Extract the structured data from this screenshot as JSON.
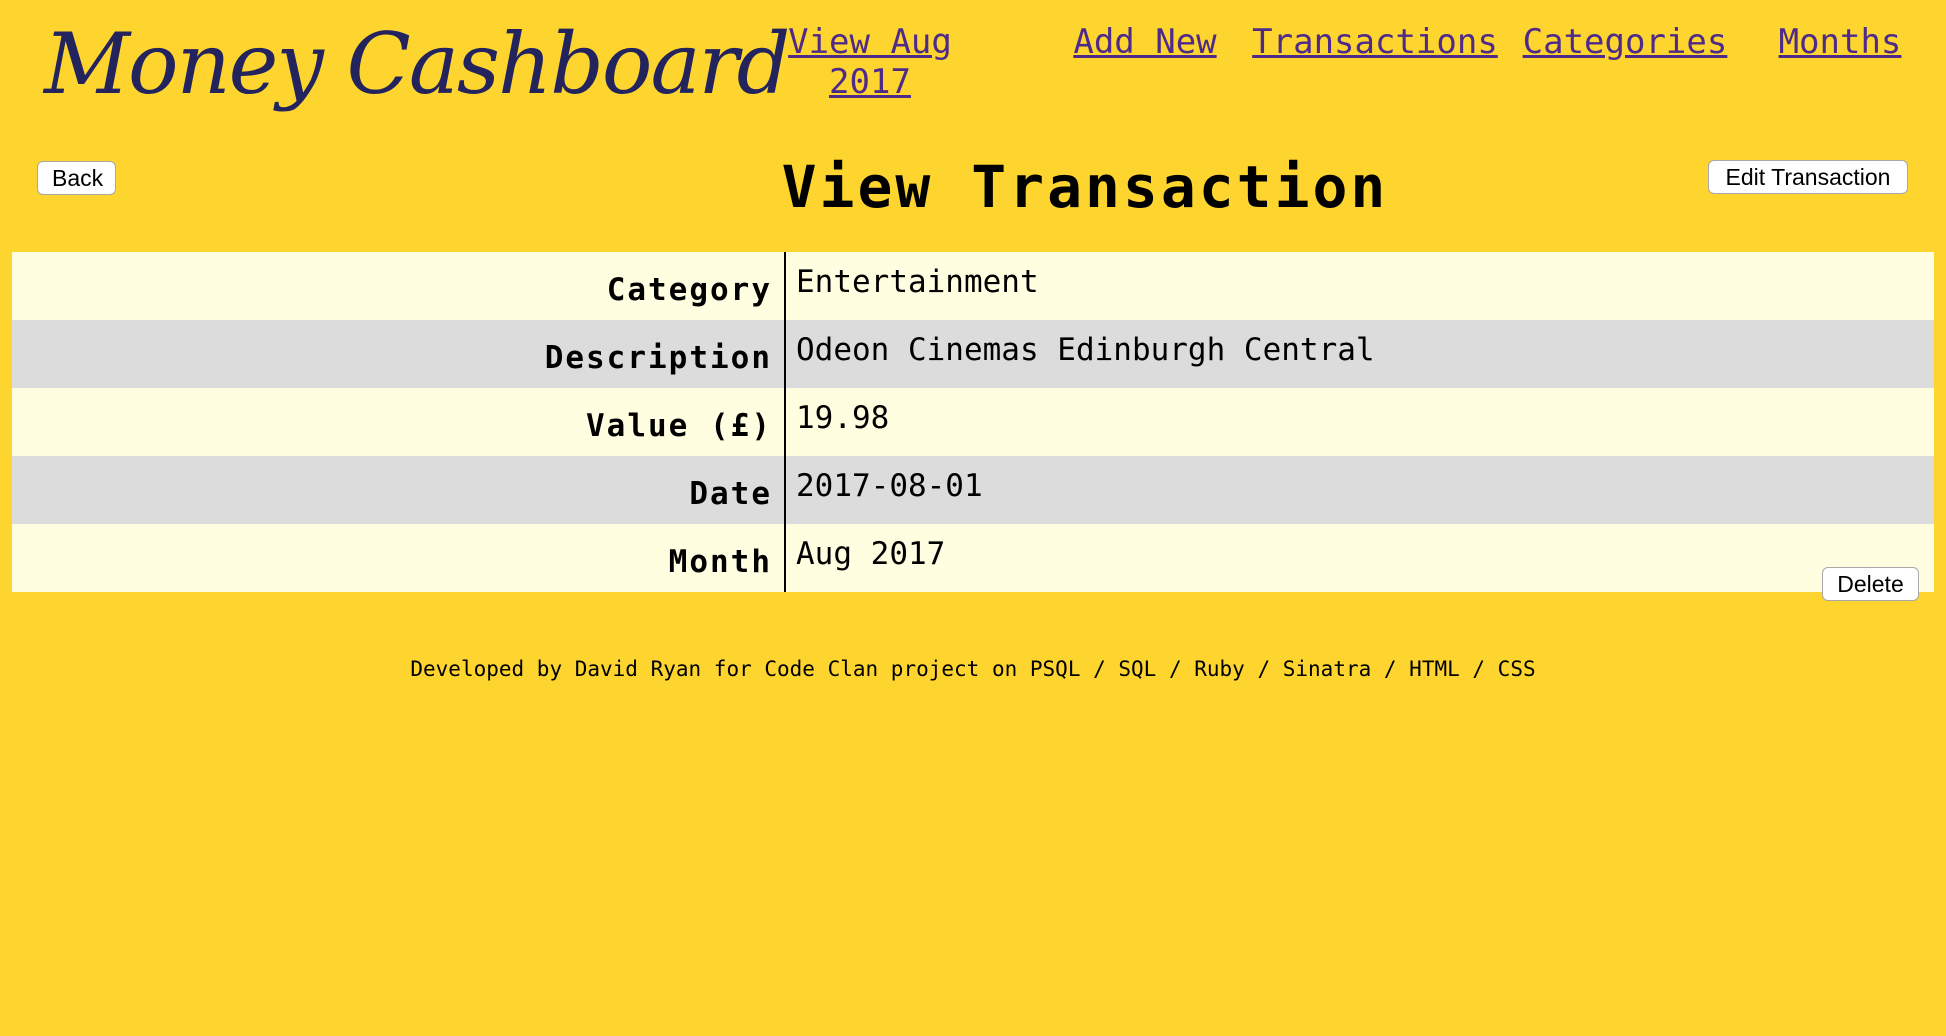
{
  "header": {
    "logo": "Money Cashboard",
    "nav": {
      "view_month": "View Aug 2017",
      "add_new": "Add New",
      "transactions": "Transactions",
      "categories": "Categories",
      "months": "Months"
    }
  },
  "main": {
    "back_label": "Back",
    "title": "View Transaction",
    "edit_label": "Edit Transaction",
    "delete_label": "Delete",
    "details": [
      {
        "label": "Category",
        "value": "Entertainment"
      },
      {
        "label": "Description",
        "value": "Odeon Cinemas Edinburgh Central"
      },
      {
        "label": "Value (£)",
        "value": "19.98"
      },
      {
        "label": "Date",
        "value": "2017-08-01"
      },
      {
        "label": "Month",
        "value": "Aug 2017"
      }
    ]
  },
  "footer": {
    "text": "Developed by David Ryan for Code Clan project on PSQL / SQL / Ruby / Sinatra / HTML / CSS"
  },
  "colors": {
    "background": "#FED52F",
    "logo": "#23235E",
    "link": "#4E2A8A",
    "row_odd": "#FFFEE0",
    "row_even": "#DCDCDC"
  }
}
